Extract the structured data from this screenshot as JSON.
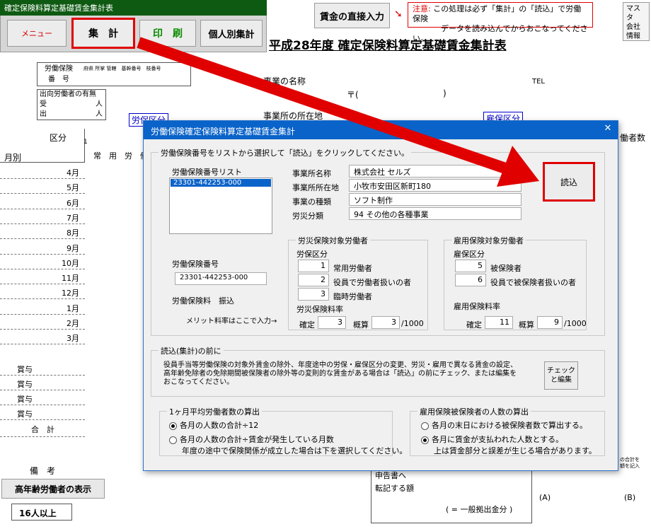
{
  "toolbar": {
    "title": "確定保険料算定基礎賃金集計表",
    "menu": "メニュー",
    "aggregate": "集　計",
    "print": "印　刷",
    "individual": "個人別集計"
  },
  "direct_input": "賃金の直接入力",
  "notice": {
    "label": "注意:",
    "line1": "この処理は必ず「集計」の「読込」で労働保険",
    "line2": "データを読み込んでからおこなってください。"
  },
  "side_right": {
    "line1": "マスタ",
    "line2": "会社",
    "line3": "情報"
  },
  "sheet": {
    "title": "平成28年度 確定保険料算定基礎賃金集計表",
    "ins_no_l1": "労働保険",
    "ins_no_l2": "番　号",
    "ins_no_sub": "府県 所掌 管轄　基幹番号　枝番号",
    "dispatch": "出向労働者の有無",
    "recv": "受",
    "out": "出",
    "person": "人",
    "biz_name": "事業の名称",
    "tel": "TEL",
    "postal": "〒(",
    "biz_addr": "事業所の所在地",
    "hoken_kubun": "労保区分",
    "koyo_kubun": "雇保区分",
    "kubun": "区分",
    "month": "月別",
    "one": "1",
    "regular_hdr": "常　用　労　働",
    "months": [
      "4月",
      "5月",
      "6月",
      "7月",
      "8月",
      "9月",
      "10月",
      "11月",
      "12月",
      "1月",
      "2月",
      "3月"
    ],
    "bonus": [
      "賞与",
      "賞与",
      "賞与",
      "賞与"
    ],
    "total": "合　計",
    "remarks": "備　考",
    "right_hdr": "働者数",
    "senior_title": "高年齢労働者の表示",
    "senior_cnt": "16人以上",
    "transfer_l1": "申告書へ",
    "transfer_l2": "転記する額",
    "general": "( = 一般拠出金分 )",
    "a": "(A)",
    "b": "(B)",
    "side_note1": "の合計を",
    "side_note2": "額を記入"
  },
  "dialog": {
    "title": "労働保険確定保険料算定基礎賃金集計",
    "close": "✕",
    "group_main": "労働保険番号をリストから選択して「読込」をクリックしてください。",
    "list_label": "労働保険番号リスト",
    "list_items": [
      "23301-442253-000"
    ],
    "fields": {
      "name_label": "事業所名称",
      "name": "株式会社 セルズ",
      "addr_label": "事業所所在地",
      "addr": "小牧市安田区新町180",
      "kind_label": "事業の種類",
      "kind": "ソフト制作",
      "rosai_label": "労災分類",
      "rosai": "94 その他の各種事業"
    },
    "read_button": "読込",
    "rosai_group": {
      "title": "労災保険対象労働者",
      "kubun": "労保区分",
      "items": [
        {
          "num": "1",
          "label": "常用労働者"
        },
        {
          "num": "2",
          "label": "役員で労働者扱いの者"
        },
        {
          "num": "3",
          "label": "臨時労働者"
        }
      ],
      "rate_label": "労災保険料率",
      "kakutei": "確定",
      "kakutei_val": "3",
      "gaisan": "概算",
      "gaisan_val": "3",
      "unit": "/1000"
    },
    "koyo_group": {
      "title": "雇用保険対象労働者",
      "kubun": "雇保区分",
      "items": [
        {
          "num": "5",
          "label": "被保険者"
        },
        {
          "num": "6",
          "label": "役員で被保険者扱いの者"
        }
      ],
      "rate_label": "雇用保険料率",
      "kakutei": "確定",
      "kakutei_val": "11",
      "gaisan": "概算",
      "gaisan_val": "9",
      "unit": "/1000"
    },
    "ins_no_label": "労働保険番号",
    "ins_no": "23301-442253-000",
    "premium_label": "労働保険料　振込",
    "merit_label": "メリット料率はここで入力→",
    "before_group": "読込(集計)の前に",
    "before_text": "役員手当等労働保険の対象外賃金の除外、年度途中の労保・雇保区分の変更、労災・雇用で異なる賃金の設定、高年齢免除者の免除期間被保険者の除外等の変則的な賃金がある場合は「読込」の前にチェック、または編集をおこなってください。",
    "check_btn_l1": "チェック",
    "check_btn_l2": "と編集",
    "avg_group": "1ヶ月平均労働者数の算出",
    "avg_opt1": "各月の人数の合計÷12",
    "avg_opt2": "各月の人数の合計÷賃金が発生している月数",
    "avg_note": "年度の途中で保険関係が成立した場合は下を選択してください。",
    "koyo_cnt_group": "雇用保険被保険者の人数の算出",
    "koyo_opt1": "各月の末日における被保険者数で算出する。",
    "koyo_opt2": "各月に賃金が支払われた人数とする。",
    "koyo_note": "上は賃金部分と誤差が生じる場合があります。"
  },
  "colors": {
    "accent_red": "#e00000",
    "dialog_title": "#0a63c9",
    "green_text": "#0a8a00",
    "red_text": "#d40000",
    "blue_text": "#0000cc"
  }
}
